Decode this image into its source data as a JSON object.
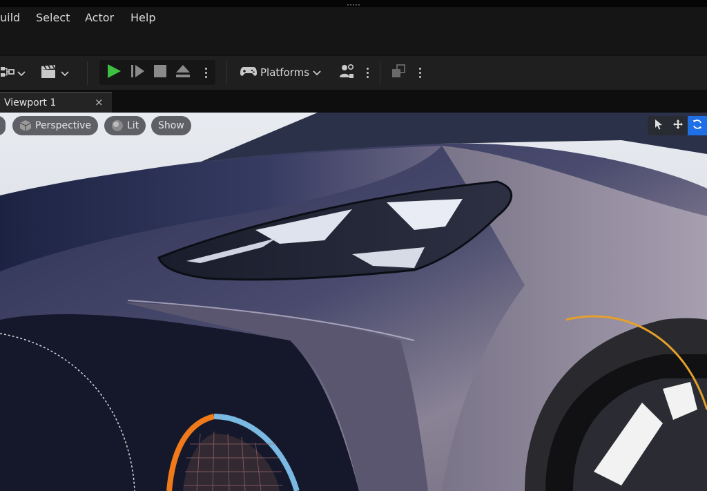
{
  "menu": {
    "items": [
      {
        "id": "build",
        "label": "uild"
      },
      {
        "id": "select",
        "label": "Select"
      },
      {
        "id": "actor",
        "label": "Actor"
      },
      {
        "id": "help",
        "label": "Help"
      }
    ]
  },
  "toolbar": {
    "platforms_label": "Platforms",
    "icons": [
      "blueprint-icon",
      "cinematics-icon",
      "play-icon",
      "advance-frame-icon",
      "stop-icon",
      "eject-icon",
      "gamepad-icon",
      "user-settings-icon",
      "layout-icon"
    ],
    "play_color": "#3fbf3f"
  },
  "tabs": {
    "viewport_label": "Viewport 1",
    "close_glyph": "×"
  },
  "viewport": {
    "view_mode_label": "Perspective",
    "lit_label": "Lit",
    "show_label": "Show",
    "active_tool": "rotate",
    "accent_color": "#1f6fe6"
  }
}
